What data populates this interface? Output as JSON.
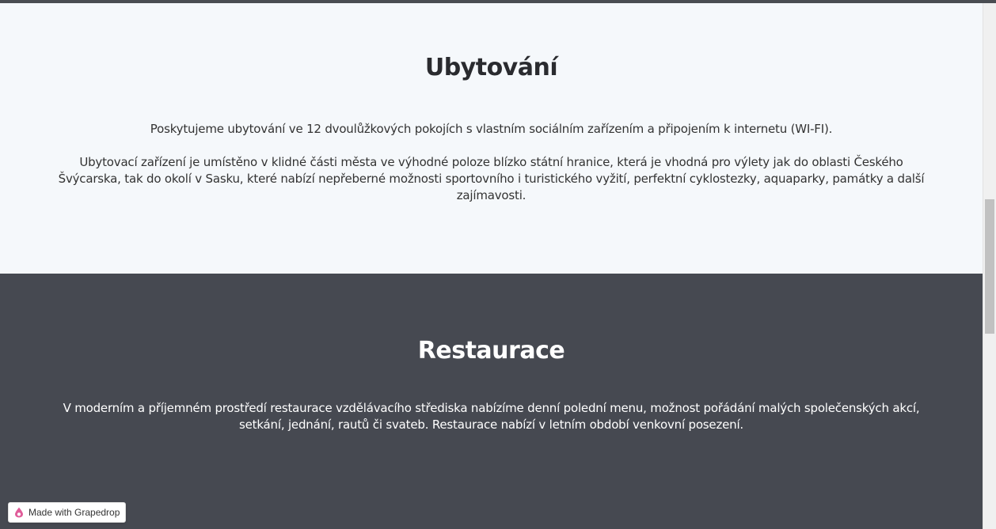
{
  "accommodation": {
    "title": "Ubytování",
    "paragraph1": "Poskytujeme ubytování ve 12 dvoulůžkových pokojích s vlastním sociálním zařízením a připojením k internetu (WI-FI).",
    "paragraph2": "Ubytovací zařízení je umístěno v klidné části města ve výhodné poloze blízko státní hranice, která je vhodná pro výlety jak do oblasti Českého Švýcarska, tak do okolí v Sasku, které nabízí nepřeberné možnosti sportovního i turistického vyžití, perfektní cyklostezky, aquaparky, památky a další zajímavosti."
  },
  "restaurant": {
    "title": "Restaurace",
    "paragraph": "V moderním a příjemném prostředí restaurace vzdělávacího střediska nabízíme denní polední menu, možnost pořádání malých společenských akcí, setkání, jednání, rautů či svateb. Restaurace nabízí v letním období venkovní posezení."
  },
  "badge": {
    "label": "Made with Grapedrop",
    "icon": "grapedrop-drop-icon",
    "icon_color": "#e05d9a"
  },
  "colors": {
    "light_bg": "#f5f8fb",
    "dark_bg": "#464951"
  }
}
